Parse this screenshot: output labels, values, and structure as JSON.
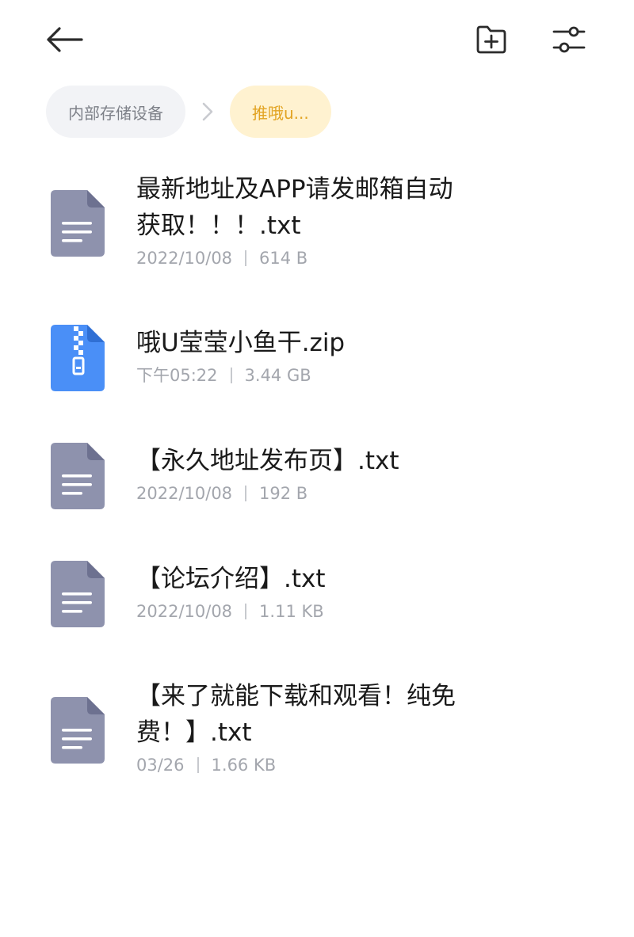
{
  "header": {
    "back_icon": "arrow-left-icon",
    "new_folder_icon": "folder-plus-icon",
    "filter_icon": "sliders-icon"
  },
  "breadcrumb": {
    "root_label": "内部存储设备",
    "separator_icon": "chevron-right-icon",
    "current_label": "推哦u...",
    "root_bg": "#f2f3f6",
    "current_bg": "#fff2d0",
    "current_color": "#e2a321"
  },
  "files": [
    {
      "name_line1": "最新地址及APP请发邮箱自动",
      "name_line2": "获取！！！.txt",
      "date": "2022/10/08",
      "size": "614 B",
      "type": "document",
      "icon": "text-file-icon",
      "icon_color": "#8e92ad"
    },
    {
      "name": "哦U莹莹小鱼干.zip",
      "date": "下午05:22",
      "size": "3.44 GB",
      "type": "archive",
      "icon": "zip-file-icon",
      "icon_color": "#4a8ff7"
    },
    {
      "name": "【永久地址发布页】.txt",
      "date": "2022/10/08",
      "size": "192 B",
      "type": "document",
      "icon": "text-file-icon",
      "icon_color": "#8e92ad"
    },
    {
      "name": "【论坛介绍】.txt",
      "date": "2022/10/08",
      "size": "1.11 KB",
      "type": "document",
      "icon": "text-file-icon",
      "icon_color": "#8e92ad"
    },
    {
      "name_line1": "【来了就能下载和观看！纯免",
      "name_line2": "费！】.txt",
      "date": "03/26",
      "size": "1.66 KB",
      "type": "document",
      "icon": "text-file-icon",
      "icon_color": "#8e92ad"
    }
  ]
}
